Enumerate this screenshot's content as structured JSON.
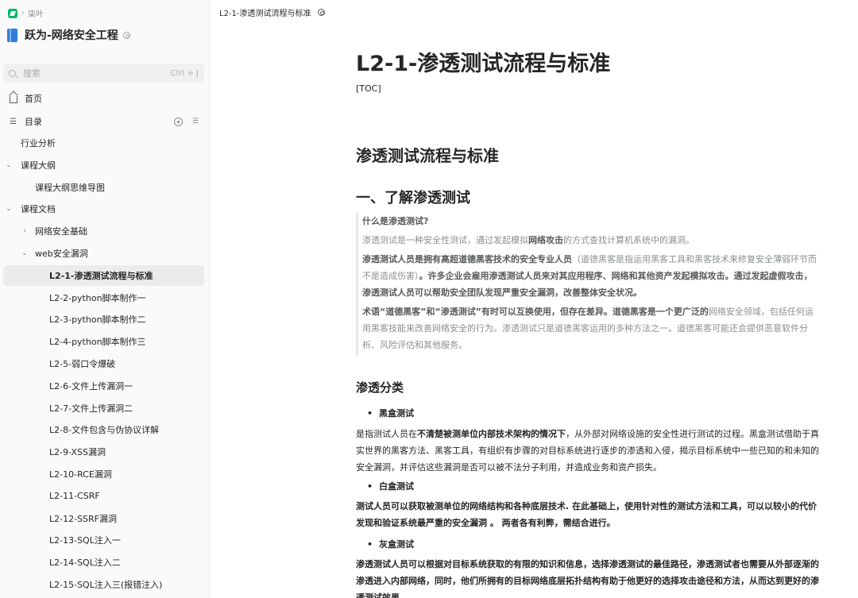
{
  "breadcrumb": {
    "workspace": "柒叶"
  },
  "book": {
    "title": "跃为-网络安全工程"
  },
  "search": {
    "placeholder": "搜索",
    "shortcut": "Ctrl + J"
  },
  "nav": {
    "home": "首页",
    "toc": "目录"
  },
  "tree": [
    {
      "label": "行业分析",
      "level": 0,
      "caret": ""
    },
    {
      "label": "课程大纲",
      "level": 0,
      "caret": "⌄"
    },
    {
      "label": "课程大纲思维导图",
      "level": 1,
      "caret": ""
    },
    {
      "label": "课程文档",
      "level": 0,
      "caret": "⌄"
    },
    {
      "label": "网络安全基础",
      "level": 1,
      "caret": "›"
    },
    {
      "label": "web安全漏洞",
      "level": 1,
      "caret": "⌄"
    },
    {
      "label": "L2-1-渗透测试流程与标准",
      "level": 2,
      "caret": "",
      "active": true
    },
    {
      "label": "L2-2-python脚本制作一",
      "level": 2,
      "caret": ""
    },
    {
      "label": "L2-3-python脚本制作二",
      "level": 2,
      "caret": ""
    },
    {
      "label": "L2-4-python脚本制作三",
      "level": 2,
      "caret": ""
    },
    {
      "label": "L2-5-弱口令爆破",
      "level": 2,
      "caret": ""
    },
    {
      "label": "L2-6-文件上传漏洞一",
      "level": 2,
      "caret": ""
    },
    {
      "label": "L2-7-文件上传漏洞二",
      "level": 2,
      "caret": ""
    },
    {
      "label": "L2-8-文件包含与伪协议详解",
      "level": 2,
      "caret": ""
    },
    {
      "label": "L2-9-XSS漏洞",
      "level": 2,
      "caret": ""
    },
    {
      "label": "L2-10-RCE漏洞",
      "level": 2,
      "caret": ""
    },
    {
      "label": "L2-11-CSRF",
      "level": 2,
      "caret": ""
    },
    {
      "label": "L2-12-SSRF漏洞",
      "level": 2,
      "caret": ""
    },
    {
      "label": "L2-13-SQL注入一",
      "level": 2,
      "caret": ""
    },
    {
      "label": "L2-14-SQL注入二",
      "level": 2,
      "caret": ""
    },
    {
      "label": "L2-15-SQL注入三(报错注入)",
      "level": 2,
      "caret": ""
    }
  ],
  "topbar": {
    "doc_name": "L2-1-渗透测试流程与标准"
  },
  "doc": {
    "title": "L2-1-渗透测试流程与标准",
    "toc": "[TOC]",
    "h1": "渗透测试流程与标准",
    "h2": "一、了解渗透测试",
    "quote": {
      "q": "什么是渗透测试?",
      "p1_a": "渗透测试是一种安全性测试，通过发起模拟",
      "p1_b": "网络攻击",
      "p1_c": "的方式查找计算机系统中的漏洞。",
      "p2_a": "渗透测试人员是拥有高超道德黑客技术的安全专业人员",
      "p2_b": "（道德黑客是指运用黑客工具和黑客技术来修复安全薄弱环节而不是造成伤害）",
      "p2_c": "。许多企业会雇用渗透测试人员来对其应用程序、网络和其他资产发起模拟攻击。通过发起虚假攻击，渗透测试人员可以帮助安全团队发现严重安全漏洞，改善整体安全状况。",
      "p3_a": "术语“道德黑客”和“渗透测试”有时可以互换使用，但存在差异。道德黑客是一个更广泛的",
      "p3_b": "网络安全领域，包括任何运用黑客技能来改善网络安全的行为。渗透测试只是道德黑客运用的多种方法之一。道德黑客可能还会提供恶意软件分析、风险评估和其他服务。"
    },
    "h3": "渗透分类",
    "black": {
      "title": "黑盒测试",
      "a": "是指测试人员在",
      "b": "不清楚被测单位内部技术架构的情况下",
      "c": "，从外部对网络设施的安全性进行测试的过程。黑盒测试借助于真实世界的黑客方法、黑客工具，有组织有步骤的对目标系统进行逐步的渗透和入侵，揭示目标系统中一些已知的和未知的安全漏洞，并评估这些漏洞是否可以被不法分子利用，并造成业务和资产损失。"
    },
    "white": {
      "title": "白盒测试",
      "text": "测试人员可以获取被测单位的网络结构和各种底层技术. 在此基础上，使用针对性的测试方法和工具，可以以较小的代价发现和验证系统最严重的安全漏洞 。 两者各有利弊，需结合进行。"
    },
    "gray": {
      "title": "灰盒测试",
      "text": "渗透测试人员可以根据对目标系统获取的有限的知识和信息，选择渗透测试的最佳路径，渗透测试者也需要从外部逐渐的渗透进入内部网络，同时，他们所拥有的目标网络底层拓扑结构有助于他更好的选择攻击途径和方法，从而达到更好的渗透测试效果。"
    }
  }
}
